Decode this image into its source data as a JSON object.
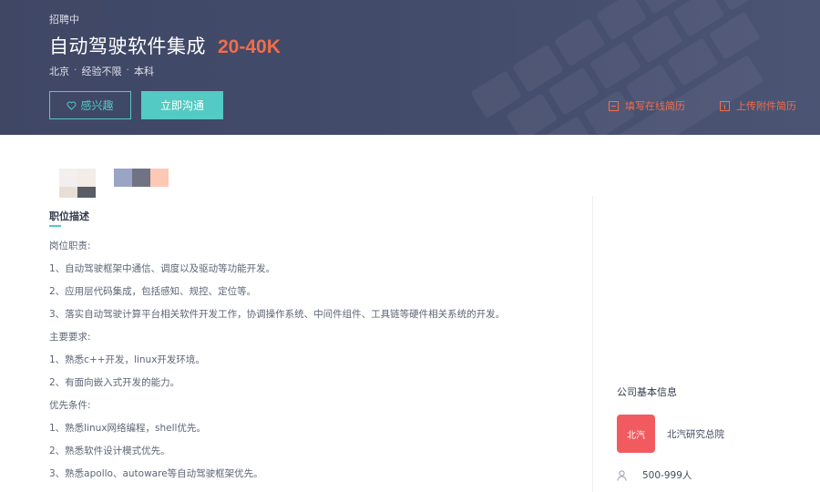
{
  "header": {
    "status": "招聘中",
    "job_title": "自动驾驶软件集成",
    "salary": "20-40K",
    "meta": [
      "北京",
      "经验不限",
      "本科"
    ],
    "interest_label": "感兴趣",
    "chat_label": "立即沟通",
    "resume_online_label": "填写在线简历",
    "resume_upload_label": "上传附件简历"
  },
  "thumbnails": {
    "a_colors": [
      "#f2efee",
      "#f4ece6",
      "#e9ded5",
      "#595d66"
    ],
    "b_colors": [
      "#9aa4c5",
      "#6f7384",
      "#fdc8b5"
    ]
  },
  "description": {
    "section_title": "职位描述",
    "lines": [
      "岗位职责:",
      "1、自动驾驶框架中通信、调度以及驱动等功能开发。",
      "2、应用层代码集成，包括感知、规控、定位等。",
      "3、落实自动驾驶计算平台相关软件开发工作，协调操作系统、中间件组件、工具链等硬件相关系统的开发。",
      "主要要求:",
      "1、熟悉c++开发，linux开发环境。",
      "2、有面向嵌入式开发的能力。",
      "优先条件:",
      "1、熟悉linux网络编程，shell优先。",
      "2、熟悉软件设计模式优先。",
      "3、熟悉apollo、autoware等自动驾驶框架优先。"
    ]
  },
  "company": {
    "section_title": "公司基本信息",
    "logo_text": "北汽",
    "name": "北汽研究总院",
    "size": "500-999人"
  },
  "colors": {
    "banner": "#434b6b",
    "accent": "#53cac3",
    "salary": "#f26d48",
    "logo_bg": "#f15a5e"
  },
  "icons": {
    "interest": "heart-icon",
    "resume_online": "document-icon",
    "resume_upload": "upload-icon",
    "size": "person-icon"
  }
}
